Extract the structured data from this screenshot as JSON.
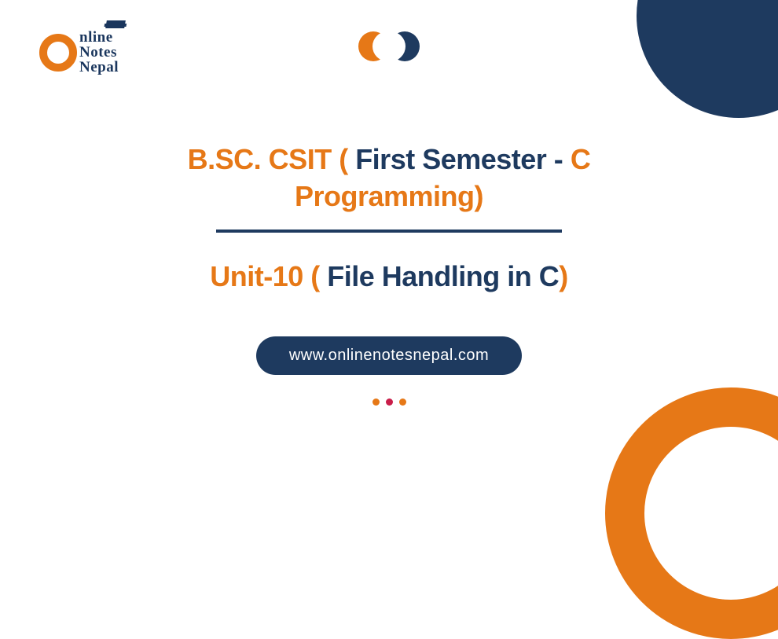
{
  "logo": {
    "line1": "nline",
    "line2": "Notes",
    "line3": "Nepal"
  },
  "heading": {
    "part1": "B.SC. CSIT ( ",
    "part2": "First Semester - ",
    "part3": "C Programming",
    "part4": ")",
    "unit_part1": "Unit-10 ( ",
    "unit_part2": "File Handling in C",
    "unit_part3": ")"
  },
  "url": "www.onlinenotesnepal.com",
  "colors": {
    "orange": "#e67817",
    "navy": "#1e3a5f"
  }
}
